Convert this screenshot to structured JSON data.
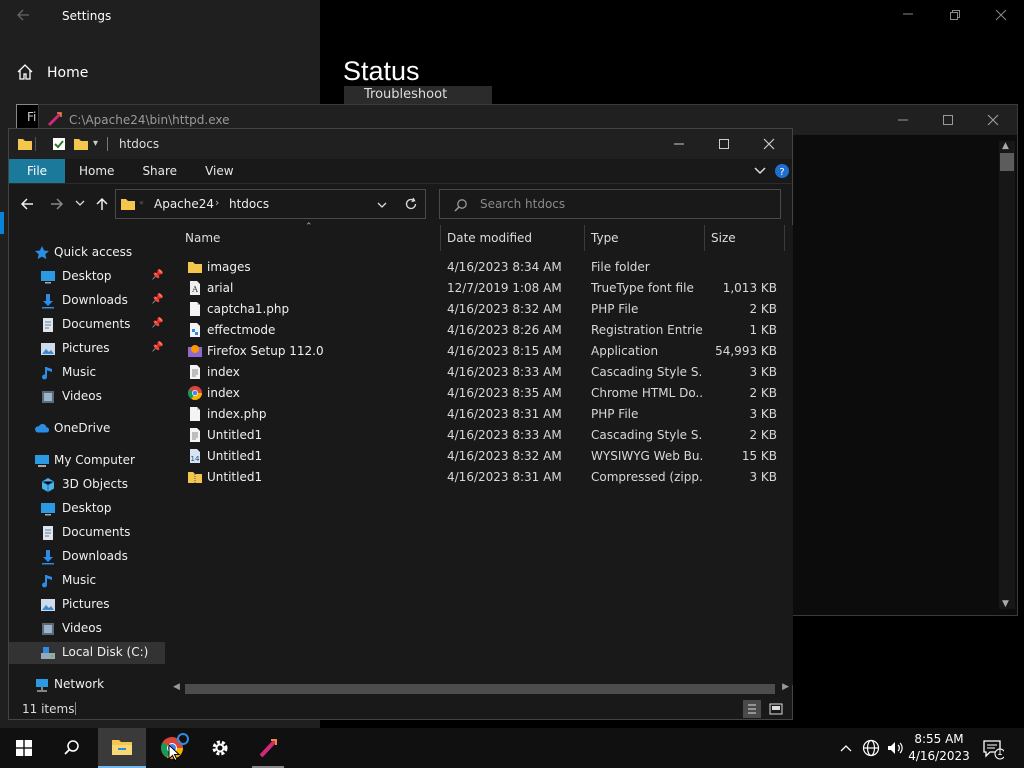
{
  "settings": {
    "title": "Settings",
    "home_label": "Home",
    "find_placeholder": "Fi",
    "status_heading": "Status",
    "troubleshoot_label": "Troubleshoot"
  },
  "console": {
    "title": "C:\\Apache24\\bin\\httpd.exe"
  },
  "explorer": {
    "title": "htdocs",
    "ribbon_tabs": [
      "File",
      "Home",
      "Share",
      "View"
    ],
    "breadcrumb": [
      "Apache24",
      "htdocs"
    ],
    "search_placeholder": "Search htdocs",
    "columns": {
      "name": "Name",
      "date": "Date modified",
      "type": "Type",
      "size": "Size"
    },
    "nav": {
      "quick_access": "Quick access",
      "desktop": "Desktop",
      "downloads": "Downloads",
      "documents": "Documents",
      "pictures": "Pictures",
      "music": "Music",
      "videos": "Videos",
      "onedrive": "OneDrive",
      "my_computer": "My Computer",
      "objects_3d": "3D Objects",
      "pc_desktop": "Desktop",
      "pc_documents": "Documents",
      "pc_downloads": "Downloads",
      "pc_music": "Music",
      "pc_pictures": "Pictures",
      "pc_videos": "Videos",
      "local_disk": "Local Disk (C:)",
      "network": "Network"
    },
    "files": [
      {
        "name": "images",
        "date": "4/16/2023 8:34 AM",
        "type": "File folder",
        "size": "",
        "icon": "folder-icon"
      },
      {
        "name": "arial",
        "date": "12/7/2019 1:08 AM",
        "type": "TrueType font file",
        "size": "1,013 KB",
        "icon": "font-file-icon"
      },
      {
        "name": "captcha1.php",
        "date": "4/16/2023 8:32 AM",
        "type": "PHP File",
        "size": "2 KB",
        "icon": "blank-file-icon"
      },
      {
        "name": "effectmode",
        "date": "4/16/2023 8:26 AM",
        "type": "Registration Entries",
        "size": "1 KB",
        "icon": "registry-file-icon"
      },
      {
        "name": "Firefox Setup 112.0",
        "date": "4/16/2023 8:15 AM",
        "type": "Application",
        "size": "54,993 KB",
        "icon": "firefox-installer-icon"
      },
      {
        "name": "index",
        "date": "4/16/2023 8:33 AM",
        "type": "Cascading Style S...",
        "size": "3 KB",
        "icon": "css-file-icon"
      },
      {
        "name": "index",
        "date": "4/16/2023 8:35 AM",
        "type": "Chrome HTML Do...",
        "size": "2 KB",
        "icon": "chrome-html-icon"
      },
      {
        "name": "index.php",
        "date": "4/16/2023 8:31 AM",
        "type": "PHP File",
        "size": "3 KB",
        "icon": "blank-file-icon"
      },
      {
        "name": "Untitled1",
        "date": "4/16/2023 8:33 AM",
        "type": "Cascading Style S...",
        "size": "2 KB",
        "icon": "css-file-icon"
      },
      {
        "name": "Untitled1",
        "date": "4/16/2023 8:32 AM",
        "type": "WYSIWYG Web Bu...",
        "size": "15 KB",
        "icon": "wysiwyg-file-icon"
      },
      {
        "name": "Untitled1",
        "date": "4/16/2023 8:31 AM",
        "type": "Compressed (zipp...",
        "size": "3 KB",
        "icon": "zip-folder-icon"
      }
    ],
    "status": "11 items"
  },
  "taskbar": {
    "time": "8:55 AM",
    "date": "4/16/2023",
    "notification_count": "1"
  },
  "colors": {
    "accent": "#1b7a9c",
    "folder": "#f4c64e",
    "windows_blue": "#0a84d6"
  }
}
